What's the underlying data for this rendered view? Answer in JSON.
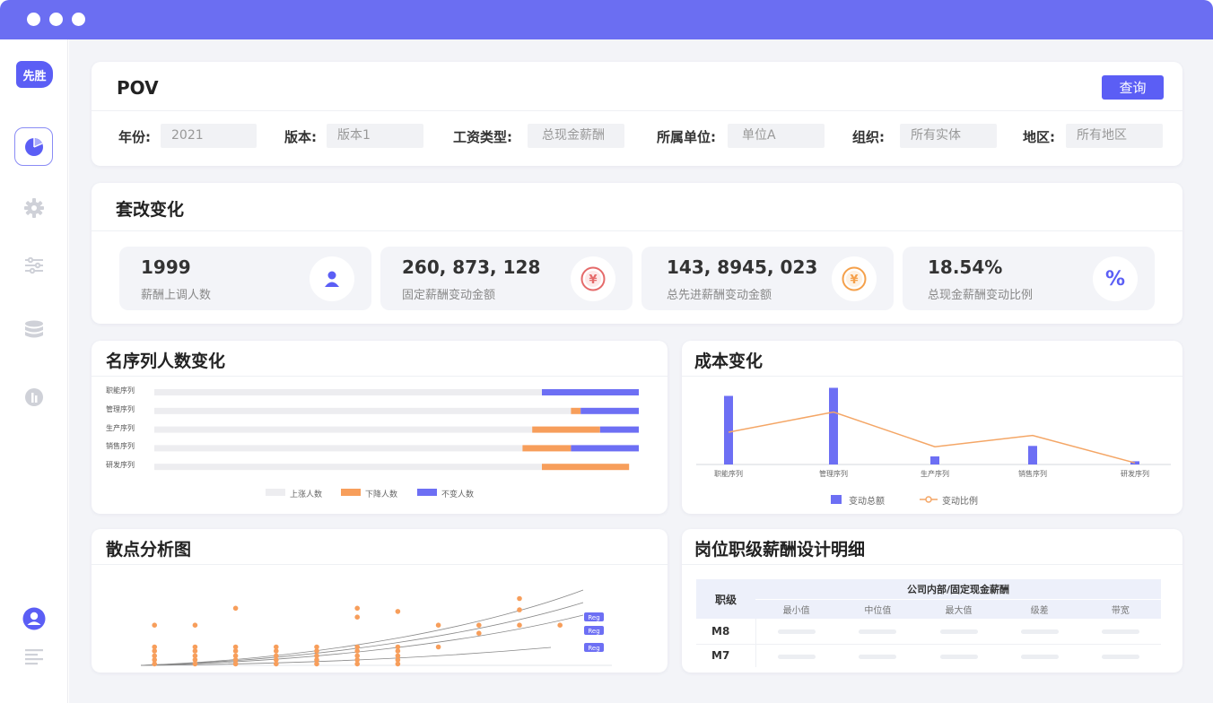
{
  "app": {
    "logo": "先胜"
  },
  "sidebar": {
    "icons": [
      "pie-chart-icon",
      "gear-icon",
      "sliders-icon",
      "database-icon",
      "chart-circle-icon",
      "user-icon",
      "menu-lines-icon"
    ]
  },
  "pov": {
    "title": "POV",
    "query_label": "查询",
    "filters": [
      {
        "label": "年份:",
        "value": "2021"
      },
      {
        "label": "版本:",
        "value": "版本1"
      },
      {
        "label": "工资类型:",
        "value": "总现金薪酬"
      },
      {
        "label": "所属单位:",
        "value": "单位A"
      },
      {
        "label": "组织:",
        "value": "所有实体"
      },
      {
        "label": "地区:",
        "value": "所有地区"
      }
    ]
  },
  "reform": {
    "title": "套改变化",
    "stats": [
      {
        "value": "1999",
        "label": "薪酬上调人数",
        "icon": "person-icon",
        "color": "#5b5ef5"
      },
      {
        "value": "260, 873, 128",
        "label": "固定薪酬变动金额",
        "icon": "yen-icon",
        "color": "#e56a6a"
      },
      {
        "value": "143, 8945, 023",
        "label": "总先进薪酬变动金额",
        "icon": "yen-icon",
        "color": "#f5a04a"
      },
      {
        "value": "18.54%",
        "label": "总现金薪酬变动比例",
        "icon": "percent-icon",
        "color": "#5b5ef5"
      }
    ]
  },
  "headcount": {
    "title": "名序列人数变化",
    "legend": [
      "上涨人数",
      "下降人数",
      "不变人数"
    ],
    "colors": [
      "#ededf0",
      "#f79e5b",
      "#6d6ff4"
    ]
  },
  "cost": {
    "title": "成本变化",
    "legend": [
      "变动总额",
      "变动比例"
    ],
    "colors": [
      "#6d6ff4",
      "#f4a666"
    ]
  },
  "scatter": {
    "title": "散点分析图",
    "badges": [
      "Reg",
      "Reg",
      "Reg"
    ]
  },
  "detail": {
    "title": "岗位职级薪酬设计明细",
    "group_header": "公司内部/固定现金薪酬",
    "row_header": "职级",
    "columns": [
      "最小值",
      "中位值",
      "最大值",
      "级差",
      "带宽"
    ],
    "rows": [
      "M8",
      "M7"
    ]
  },
  "chart_data": [
    {
      "type": "bar",
      "title": "名序列人数变化",
      "orientation": "horizontal",
      "stacked": true,
      "categories": [
        "职能序列",
        "管理序列",
        "生产序列",
        "销售序列",
        "研发序列"
      ],
      "series": [
        {
          "name": "上涨人数",
          "values": [
            80,
            86,
            78,
            76,
            80
          ]
        },
        {
          "name": "下降人数",
          "values": [
            0,
            2,
            14,
            10,
            18
          ]
        },
        {
          "name": "不变人数",
          "values": [
            20,
            12,
            8,
            14,
            0
          ]
        }
      ],
      "legend_position": "bottom"
    },
    {
      "type": "bar",
      "title": "成本变化",
      "categories": [
        "职能序列",
        "管理序列",
        "生产序列",
        "销售序列",
        "研发序列"
      ],
      "series": [
        {
          "name": "变动总额",
          "type": "bar",
          "values": [
            85,
            95,
            10,
            23,
            4
          ]
        },
        {
          "name": "变动比例",
          "type": "line",
          "values": [
            40,
            65,
            22,
            36,
            2
          ]
        }
      ],
      "legend_position": "bottom"
    },
    {
      "type": "scatter",
      "title": "散点分析图",
      "points": [
        [
          1,
          52
        ],
        [
          1,
          25
        ],
        [
          1,
          20
        ],
        [
          1,
          14
        ],
        [
          1,
          9
        ],
        [
          1,
          4
        ],
        [
          2,
          52
        ],
        [
          2,
          25
        ],
        [
          2,
          20
        ],
        [
          2,
          14
        ],
        [
          2,
          9
        ],
        [
          2,
          4
        ],
        [
          3,
          73
        ],
        [
          3,
          25
        ],
        [
          3,
          20
        ],
        [
          3,
          14
        ],
        [
          3,
          9
        ],
        [
          3,
          4
        ],
        [
          4,
          25
        ],
        [
          4,
          20
        ],
        [
          4,
          14
        ],
        [
          4,
          9
        ],
        [
          4,
          4
        ],
        [
          5,
          25
        ],
        [
          5,
          20
        ],
        [
          5,
          14
        ],
        [
          5,
          9
        ],
        [
          5,
          4
        ],
        [
          6,
          73
        ],
        [
          6,
          62
        ],
        [
          6,
          25
        ],
        [
          6,
          20
        ],
        [
          6,
          14
        ],
        [
          6,
          9
        ],
        [
          6,
          4
        ],
        [
          7,
          69
        ],
        [
          7,
          25
        ],
        [
          7,
          20
        ],
        [
          7,
          14
        ],
        [
          7,
          9
        ],
        [
          7,
          4
        ],
        [
          8,
          52
        ],
        [
          8,
          25
        ],
        [
          9,
          52
        ],
        [
          9,
          42
        ],
        [
          10,
          85
        ],
        [
          10,
          71
        ],
        [
          10,
          52
        ],
        [
          11,
          52
        ]
      ],
      "curves": 4
    }
  ]
}
